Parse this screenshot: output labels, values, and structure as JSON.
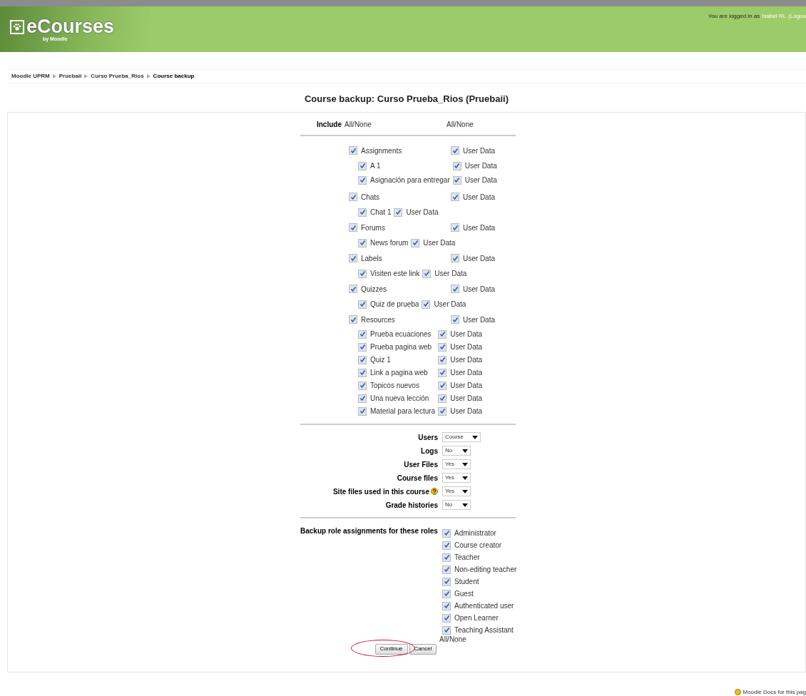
{
  "header": {
    "logo_text": "eCourses",
    "logo_subtext": "by Moodle",
    "login_text": "You are logged in as",
    "user_link": "Isabel RL",
    "logout_link": "(Logou"
  },
  "breadcrumb": [
    "Moodle UPRM",
    "Pruebaii",
    "Curso Prueba_Rios",
    "Course backup"
  ],
  "heading": "Course backup: Curso Prueba_Rios (Pruebaii)",
  "include_row": {
    "label": "Include",
    "all_none": "All/None",
    "user_data_all_none": "All/None"
  },
  "modules": [
    {
      "label": "Assignments",
      "checked": true,
      "user_data": "User Data",
      "user_data_checked": true,
      "children": [
        {
          "label": "A 1",
          "checked": true,
          "user_data": "User Data",
          "user_data_checked": true
        },
        {
          "label": "Asignación para entregar",
          "checked": true,
          "user_data": "User Data",
          "user_data_checked": true
        }
      ]
    },
    {
      "label": "Chats",
      "checked": true,
      "user_data": "User Data",
      "user_data_checked": true,
      "children": [
        {
          "label": "Chat 1",
          "checked": true,
          "user_data": "User Data",
          "user_data_checked": true
        }
      ]
    },
    {
      "label": "Forums",
      "checked": true,
      "user_data": "User Data",
      "user_data_checked": true,
      "children": [
        {
          "label": "News forum",
          "checked": true,
          "user_data": "User Data",
          "user_data_checked": true
        }
      ]
    },
    {
      "label": "Labels",
      "checked": true,
      "user_data": "User Data",
      "user_data_checked": true,
      "children": [
        {
          "label": "Visiten este link",
          "checked": true,
          "user_data": "User Data",
          "user_data_checked": true
        }
      ]
    },
    {
      "label": "Quizzes",
      "checked": true,
      "user_data": "User Data",
      "user_data_checked": true,
      "children": [
        {
          "label": "Quiz de prueba",
          "checked": true,
          "user_data": "User Data",
          "user_data_checked": true
        }
      ]
    },
    {
      "label": "Resources",
      "checked": true,
      "user_data": "User Data",
      "user_data_checked": true,
      "children": [
        {
          "label": "Prueba ecuaciones",
          "checked": true,
          "user_data": "User Data",
          "user_data_checked": true
        },
        {
          "label": "Prueba pagina web",
          "checked": true,
          "user_data": "User Data",
          "user_data_checked": true
        },
        {
          "label": "Quiz 1",
          "checked": true,
          "user_data": "User Data",
          "user_data_checked": true
        },
        {
          "label": "Link a pagina web",
          "checked": true,
          "user_data": "User Data",
          "user_data_checked": true
        },
        {
          "label": "Topicos nuevos",
          "checked": true,
          "user_data": "User Data",
          "user_data_checked": true
        },
        {
          "label": "Una nueva lección",
          "checked": true,
          "user_data": "User Data",
          "user_data_checked": true
        },
        {
          "label": "Material para lectura",
          "checked": true,
          "user_data": "User Data",
          "user_data_checked": true
        }
      ]
    }
  ],
  "options": [
    {
      "label": "Users",
      "value": "Course",
      "has_help": false
    },
    {
      "label": "Logs",
      "value": "No",
      "has_help": false
    },
    {
      "label": "User Files",
      "value": "Yes",
      "has_help": false
    },
    {
      "label": "Course files",
      "value": "Yes",
      "has_help": false
    },
    {
      "label": "Site files used in this course",
      "value": "Yes",
      "has_help": true
    },
    {
      "label": "Grade histories",
      "value": "No",
      "has_help": false
    }
  ],
  "roles": {
    "label": "Backup role assignments for these roles",
    "items": [
      {
        "label": "Administrator",
        "checked": true
      },
      {
        "label": "Course creator",
        "checked": true
      },
      {
        "label": "Teacher",
        "checked": true
      },
      {
        "label": "Non-editing teacher",
        "checked": true
      },
      {
        "label": "Student",
        "checked": true
      },
      {
        "label": "Guest",
        "checked": true
      },
      {
        "label": "Authenticated user",
        "checked": true
      },
      {
        "label": "Open Learner",
        "checked": true
      },
      {
        "label": "Teaching Assistant",
        "checked": true
      }
    ],
    "all_none": "All/None"
  },
  "buttons": [
    "Continue",
    "Cancel"
  ],
  "footer": {
    "docs_link": "Moodle Docs for this pag"
  }
}
